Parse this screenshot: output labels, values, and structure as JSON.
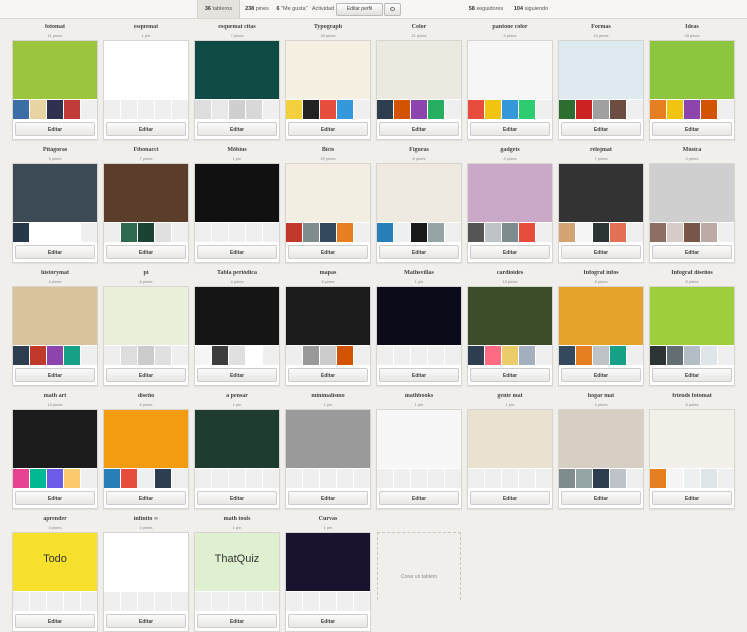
{
  "tabs": {
    "boards": {
      "count": "36",
      "label": "tableros"
    },
    "pins": {
      "count": "238",
      "label": "pines"
    },
    "likes": {
      "count": "6",
      "label": "\"Me gusta\""
    },
    "activity": {
      "label": "Actividad"
    },
    "edit_profile": "Editar perfil",
    "followers": {
      "count": "58",
      "label": "seguidores"
    },
    "following": {
      "count": "104",
      "label": "siguiendo"
    }
  },
  "edit_label": "Editar",
  "new_board_label": "Crear un tablero",
  "boards": [
    {
      "title": "fotomat",
      "count": "11 pines",
      "cover": "#9bc53d",
      "thumbs": [
        "#3a6ea5",
        "#e8d4a2",
        "#2f2f4f",
        "#c23b3b"
      ]
    },
    {
      "title": "esquemat",
      "count": "1 pin",
      "cover": "#ffffff",
      "thumbs": []
    },
    {
      "title": "esquemat citas",
      "count": "7 pines",
      "cover": "#0f4a45",
      "thumbs": [
        "#dddddd",
        "#e8e8e8",
        "#cfcfcf",
        "#d8d8d8"
      ]
    },
    {
      "title": "Typograph",
      "count": "30 pines",
      "cover": "#f5f0e1",
      "thumbs": [
        "#f4d03f",
        "#222222",
        "#e74c3c",
        "#3498db"
      ]
    },
    {
      "title": "Color",
      "count": "21 pines",
      "cover": "#ece9e1",
      "thumbs": [
        "#2c3e50",
        "#d35400",
        "#8e44ad",
        "#27ae60"
      ]
    },
    {
      "title": "pantone color",
      "count": "9 pines",
      "cover": "#f6f6f6",
      "thumbs": [
        "#e74c3c",
        "#f1c40f",
        "#3498db",
        "#2ecc71"
      ]
    },
    {
      "title": "Formas",
      "count": "10 pines",
      "cover": "#dfe9f0",
      "thumbs": [
        "#2b6e2f",
        "#cc2222",
        "#a0a0a0",
        "#6d4c41"
      ]
    },
    {
      "title": "Ideas",
      "count": "28 pines",
      "cover": "#8cc63f",
      "thumbs": [
        "#e67e22",
        "#f1c40f",
        "#8e44ad",
        "#d35400"
      ]
    },
    {
      "title": "Pitágoras",
      "count": "3 pines",
      "cover": "#3b4a55",
      "thumbs": [
        "#27384a",
        "#ffffff",
        "#ffffff",
        "#ffffff"
      ]
    },
    {
      "title": "Fibonacci",
      "count": "7 pines",
      "cover": "#5a3e2b",
      "thumbs": [
        "#eeeeee",
        "#2d6a4f",
        "#1b4332",
        "#e0e0e0"
      ]
    },
    {
      "title": "Möbius",
      "count": "1 pin",
      "cover": "#111111",
      "thumbs": []
    },
    {
      "title": "Bicis",
      "count": "20 pines",
      "cover": "#f3eee2",
      "thumbs": [
        "#c0392b",
        "#7f8c8d",
        "#34495e",
        "#e67e22"
      ]
    },
    {
      "title": "Figuras",
      "count": "8 pines",
      "cover": "#efeadf",
      "thumbs": [
        "#2980b9",
        "#ecf0f1",
        "#1a1a1a",
        "#95a5a6"
      ]
    },
    {
      "title": "gadgets",
      "count": "8 pines",
      "cover": "#c9a9c7",
      "thumbs": [
        "#555555",
        "#bdc3c7",
        "#7f8c8d",
        "#e74c3c"
      ]
    },
    {
      "title": "relojmat",
      "count": "7 pines",
      "cover": "#333333",
      "thumbs": [
        "#d4a373",
        "#f5f5f5",
        "#2d3436",
        "#e17055"
      ]
    },
    {
      "title": "Música",
      "count": "3 pines",
      "cover": "#cfcfcf",
      "thumbs": [
        "#8d6e63",
        "#d7ccc8",
        "#795548",
        "#bcaaa4"
      ]
    },
    {
      "title": "historymat",
      "count": "4 pines",
      "cover": "#d9c39a",
      "thumbs": [
        "#2c3e50",
        "#c0392b",
        "#8e44ad",
        "#16a085"
      ]
    },
    {
      "title": "pi",
      "count": "6 pines",
      "cover": "#e9f0dc",
      "thumbs": [
        "#eeeeee",
        "#dddddd",
        "#cccccc",
        "#e0e0e0"
      ]
    },
    {
      "title": "Tabla periódica",
      "count": "4 pines",
      "cover": "#151515",
      "thumbs": [
        "#f5f5f5",
        "#3d3d3d",
        "#e0e0e0",
        "#ffffff"
      ]
    },
    {
      "title": "mapas",
      "count": "8 pines",
      "cover": "#1b1b1b",
      "thumbs": [
        "#eeeeee",
        "#999999",
        "#cccccc",
        "#d35400"
      ]
    },
    {
      "title": "Mathsvillas",
      "count": "1 pin",
      "cover": "#0b0b1a",
      "thumbs": []
    },
    {
      "title": "cardioides",
      "count": "13 pines",
      "cover": "#3c4d2a",
      "thumbs": [
        "#2c3e50",
        "#ff6b81",
        "#eccc68",
        "#a4b0be"
      ]
    },
    {
      "title": "Infograf infos",
      "count": "8 pines",
      "cover": "#e4a42c",
      "thumbs": [
        "#34495e",
        "#e67e22",
        "#bdc3c7",
        "#16a085"
      ]
    },
    {
      "title": "Infograf diseños",
      "count": "8 pines",
      "cover": "#9ccf3b",
      "thumbs": [
        "#2d3436",
        "#636e72",
        "#b2bec3",
        "#dfe6e9"
      ]
    },
    {
      "title": "math art",
      "count": "13 pines",
      "cover": "#1c1c1c",
      "thumbs": [
        "#e84393",
        "#00b894",
        "#6c5ce7",
        "#fdcb6e"
      ]
    },
    {
      "title": "diseño",
      "count": "6 pines",
      "cover": "#f39c12",
      "thumbs": [
        "#2980b9",
        "#e74c3c",
        "#ecf0f1",
        "#2c3e50"
      ]
    },
    {
      "title": "a pensar",
      "count": "1 pin",
      "cover": "#1e3b2f",
      "thumbs": []
    },
    {
      "title": "minimalismo",
      "count": "1 pin",
      "cover": "#9a9a9a",
      "thumbs": []
    },
    {
      "title": "mathbooks",
      "count": "1 pin",
      "cover": "#f7f7f7",
      "thumbs": []
    },
    {
      "title": "gente mat",
      "count": "1 pin",
      "cover": "#e9e2d0",
      "thumbs": []
    },
    {
      "title": "hogar mat",
      "count": "4 pines",
      "cover": "#d8cfc4",
      "thumbs": [
        "#7f8c8d",
        "#95a5a6",
        "#2c3e50",
        "#bdc3c7"
      ]
    },
    {
      "title": "friends fotomat",
      "count": "8 pines",
      "cover": "#f3efe9",
      "thumbs": [
        "#e67e22",
        "#f5f5f5",
        "#ecf0f1",
        "#dfe6e9"
      ]
    },
    {
      "title": "aprender",
      "count": "3 pines",
      "cover": "#f7e12d",
      "cover_text": "Todo",
      "thumbs": []
    },
    {
      "title": "infinito ∞",
      "count": "3 pines",
      "cover": "#ffffff",
      "thumbs": []
    },
    {
      "title": "math tools",
      "count": "1 pin",
      "cover": "#dff0d0",
      "cover_text": "ThatQuiz",
      "thumbs": []
    },
    {
      "title": "Curvas",
      "count": "1 pin",
      "cover": "#1a1330",
      "thumbs": []
    }
  ]
}
